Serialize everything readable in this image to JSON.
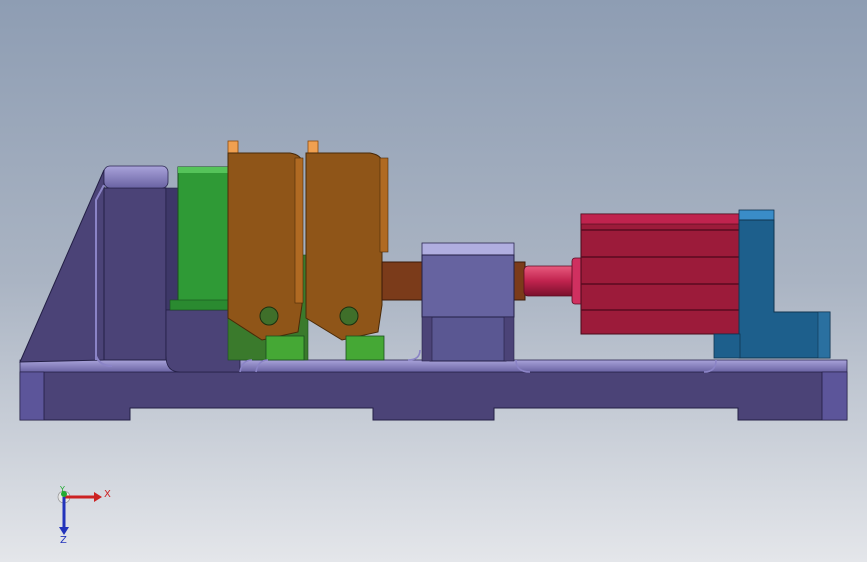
{
  "viewport": {
    "background_top": "#8e9db3",
    "background_bottom": "#e4e6ea"
  },
  "parts": {
    "base_color": "#4b4377",
    "base_highlight": "#8b84c6",
    "green_block_color": "#2f9a36",
    "jaw_color": "#8f5518",
    "jaw_tab_color": "#f0a050",
    "small_green_color": "#45a835",
    "coupling_color": "#6663a0",
    "shaft_color": "#7b3b1a",
    "rod_color": "#c0234e",
    "cylinder_color": "#9c1b3a",
    "mount_color": "#1d5f8c"
  },
  "triad": {
    "x_label": "X",
    "y_label": "Y",
    "z_label": "Z",
    "x_color": "#cc2222",
    "y_color": "#22aa33",
    "z_color": "#2233bb"
  }
}
